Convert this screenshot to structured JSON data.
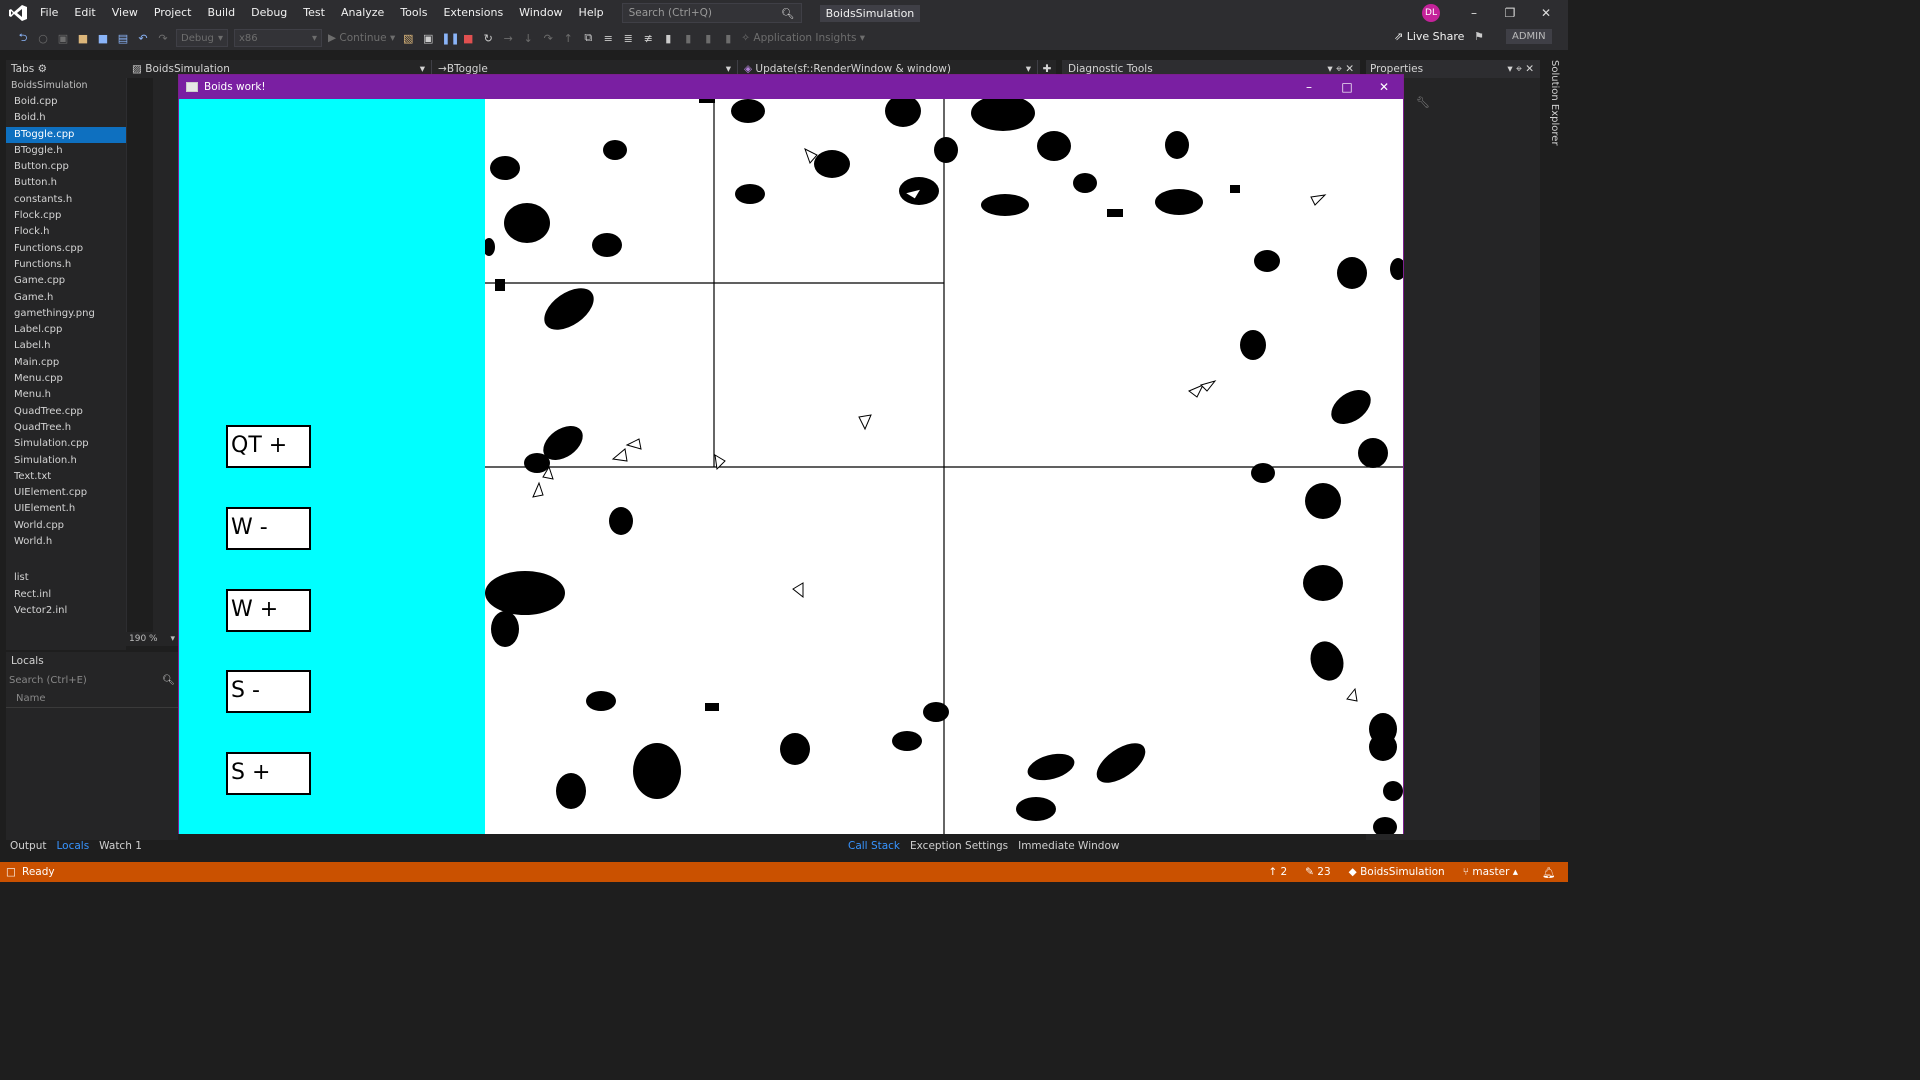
{
  "menubar": {
    "items": [
      "File",
      "Edit",
      "View",
      "Project",
      "Build",
      "Debug",
      "Test",
      "Analyze",
      "Tools",
      "Extensions",
      "Window",
      "Help"
    ],
    "search_placeholder": "Search (Ctrl+Q)",
    "app_title": "BoidsSimulation",
    "avatar_initials": "DL"
  },
  "toolbar": {
    "config": "Debug",
    "platform": "x86",
    "continue_label": "Continue",
    "app_insights": "Application Insights",
    "live_share": "Live Share",
    "admin": "ADMIN"
  },
  "tabs_panel": {
    "title": "Tabs",
    "project": "BoidsSimulation",
    "files": [
      "Boid.cpp",
      "Boid.h",
      "BToggle.cpp",
      "BToggle.h",
      "Button.cpp",
      "Button.h",
      "constants.h",
      "Flock.cpp",
      "Flock.h",
      "Functions.cpp",
      "Functions.h",
      "Game.cpp",
      "Game.h",
      "gamethingy.png",
      "Label.cpp",
      "Label.h",
      "Main.cpp",
      "Menu.cpp",
      "Menu.h",
      "QuadTree.cpp",
      "QuadTree.h",
      "Simulation.cpp",
      "Simulation.h",
      "Text.txt",
      "UIElement.cpp",
      "UIElement.h",
      "World.cpp",
      "World.h"
    ],
    "selected": "BToggle.cpp",
    "extra_files": [
      "list",
      "Rect.inl",
      "Vector2.inl"
    ]
  },
  "navbar": {
    "project": "BoidsSimulation",
    "scope": "BToggle",
    "member": "Update(sf::RenderWindow & window)"
  },
  "zoom": "190 %",
  "diagnostic_tools": "Diagnostic Tools",
  "properties": "Properties",
  "solution_explorer": "Solution Explorer",
  "locals": {
    "title": "Locals",
    "search_placeholder": "Search (Ctrl+E)",
    "column_name": "Name"
  },
  "bottom_tabs_left": [
    "Output",
    "Locals",
    "Watch 1"
  ],
  "bottom_tabs_left_active": "Locals",
  "bottom_tabs_right": [
    "Call Stack",
    "Exception Settings",
    "Immediate Window"
  ],
  "bottom_tabs_right_active": "Call Stack",
  "statusbar": {
    "state": "Ready",
    "up_count": "2",
    "edit_count": "23",
    "repo": "BoidsSimulation",
    "branch": "master"
  },
  "game_window": {
    "title": "Boids work!",
    "buttons": [
      "QT +",
      "W -",
      "W +",
      "S -",
      "S +"
    ]
  },
  "colors": {
    "game_titlebar": "#7a1fa2",
    "game_sidebar": "#00ffff",
    "statusbar": "#ca5100",
    "selected_file": "#0e70c0"
  }
}
